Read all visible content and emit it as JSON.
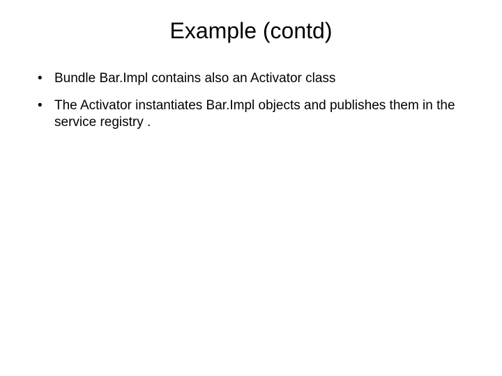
{
  "slide": {
    "title": "Example (contd)",
    "bullets": [
      "Bundle Bar.Impl contains also an Activator class",
      "The Activator instantiates Bar.Impl objects and publishes them in the service registry ."
    ]
  }
}
